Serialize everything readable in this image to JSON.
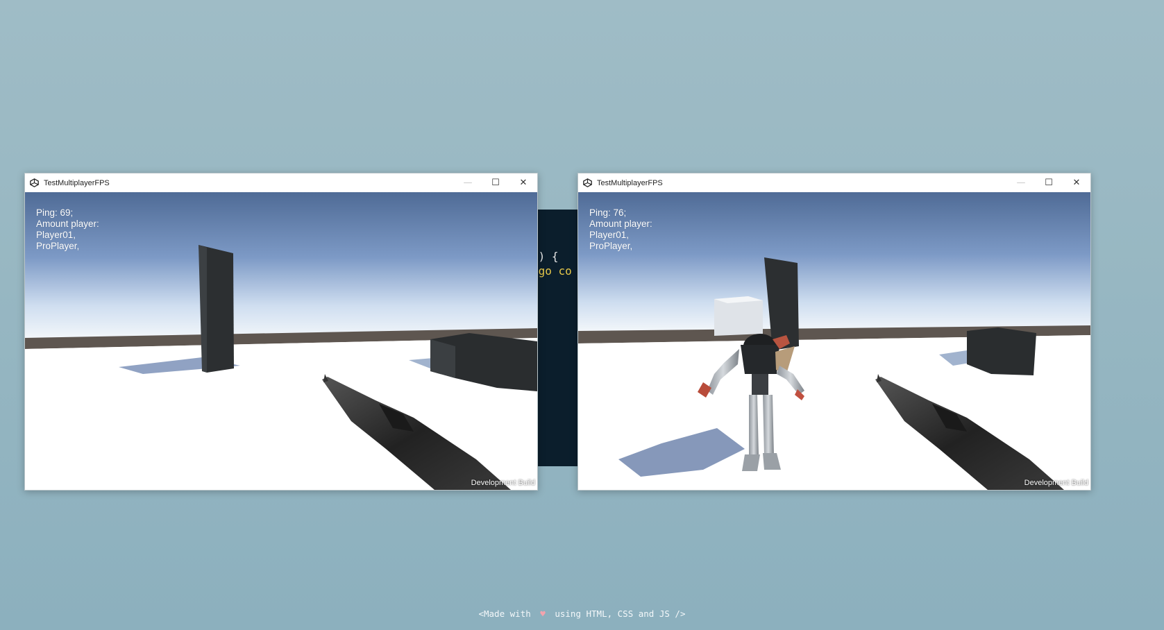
{
  "background_code": {
    "line1": "e) {",
    "line2": ".go co"
  },
  "windows": [
    {
      "title": "TestMultiplayerFPS",
      "hud": {
        "ping": "Ping: 69;",
        "amount": "Amount player:",
        "players": [
          "Player01,",
          "ProPlayer,"
        ]
      },
      "watermark": "Development Build",
      "controls": {
        "minimize": "—",
        "maximize": "☐",
        "close": "✕"
      }
    },
    {
      "title": "TestMultiplayerFPS",
      "hud": {
        "ping": "Ping: 76;",
        "amount": "Amount player:",
        "players": [
          "Player01,",
          "ProPlayer,"
        ]
      },
      "watermark": "Development Build",
      "controls": {
        "minimize": "—",
        "maximize": "☐",
        "close": "✕"
      }
    }
  ],
  "footer": {
    "prefix": "<Made with",
    "heart": "♥",
    "suffix": "using HTML, CSS and JS />"
  },
  "icons": [
    "unity-icon",
    "minimize-icon",
    "maximize-icon",
    "close-icon",
    "heart-icon"
  ],
  "colors": {
    "desktop": "#97b7c2",
    "sky_top": "#4e6b95",
    "sky_horizon": "#e8f0f6",
    "ground": "#ffffff",
    "block": "#2e3133",
    "code_bg": "#0b1e2c"
  }
}
